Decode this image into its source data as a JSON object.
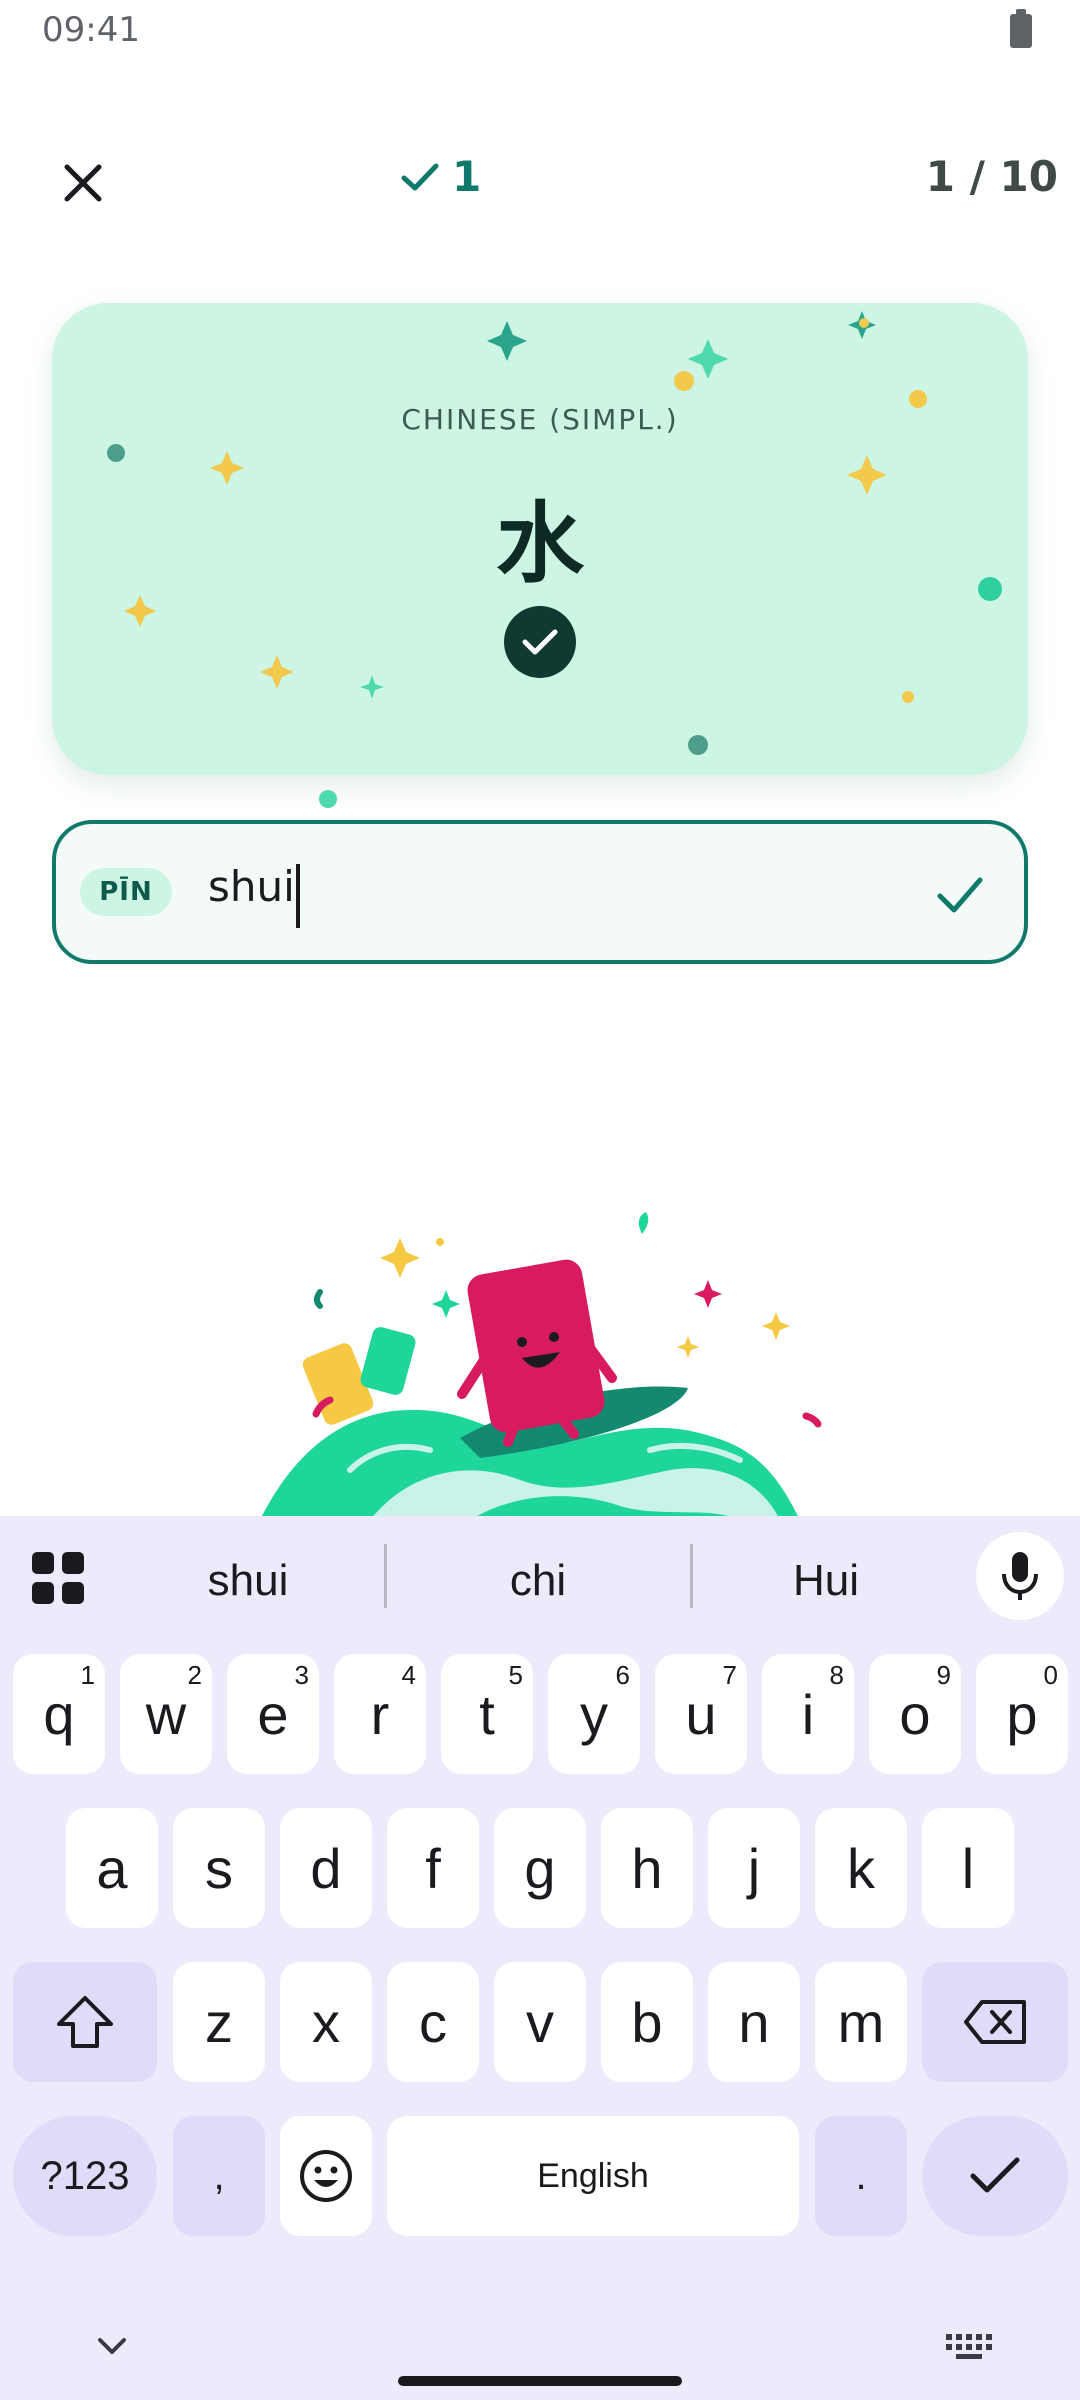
{
  "status_bar": {
    "time": "09:41"
  },
  "header": {
    "score": "1",
    "progress": "1 / 10"
  },
  "card": {
    "language": "CHINESE (SIMPL.)",
    "character": "水"
  },
  "answer": {
    "chip": "PĪN",
    "value": "shui"
  },
  "keyboard": {
    "suggestions": [
      "shui",
      "chi",
      "Hui"
    ],
    "row1": [
      {
        "key": "q",
        "hint": "1"
      },
      {
        "key": "w",
        "hint": "2"
      },
      {
        "key": "e",
        "hint": "3"
      },
      {
        "key": "r",
        "hint": "4"
      },
      {
        "key": "t",
        "hint": "5"
      },
      {
        "key": "y",
        "hint": "6"
      },
      {
        "key": "u",
        "hint": "7"
      },
      {
        "key": "i",
        "hint": "8"
      },
      {
        "key": "o",
        "hint": "9"
      },
      {
        "key": "p",
        "hint": "0"
      }
    ],
    "row2": [
      "a",
      "s",
      "d",
      "f",
      "g",
      "h",
      "j",
      "k",
      "l"
    ],
    "row3": [
      "z",
      "x",
      "c",
      "v",
      "b",
      "n",
      "m"
    ],
    "symbols_label": "?123",
    "comma": ",",
    "space_label": "English",
    "period": "."
  },
  "colors": {
    "accent": "#0f7a6b",
    "card_bg": "#cdf5e3",
    "keyboard_bg": "#eceafb",
    "key_fn_bg": "#dedcf8"
  },
  "icons": {
    "close": "close-icon",
    "score_check": "check-icon",
    "card_status": "check-circle-icon",
    "answer_status": "check-icon",
    "apps": "apps-grid-icon",
    "mic": "microphone-icon",
    "shift": "shift-icon",
    "backspace": "backspace-icon",
    "emoji": "emoji-icon",
    "enter": "check-icon",
    "hide_keyboard": "chevron-down-icon",
    "switch_keyboard": "keyboard-icon"
  }
}
